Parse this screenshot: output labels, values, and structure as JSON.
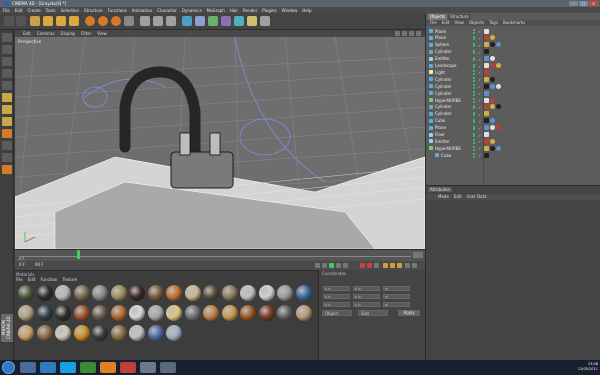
{
  "window": {
    "title": "CINEMA 4D - [Grayskull3 *]"
  },
  "menubar": [
    "File",
    "Edit",
    "Create",
    "Tools",
    "Selection",
    "Structure",
    "Functions",
    "Animation",
    "Character",
    "Dynamics",
    "MoGraph",
    "Hair",
    "Render",
    "Plugins",
    "Window",
    "Help"
  ],
  "viewport": {
    "menu": [
      "Edit",
      "Cameras",
      "Display",
      "Filter",
      "View"
    ],
    "label": "Perspective"
  },
  "timeline": {
    "start": "0 F",
    "end": "90 F",
    "frame": "90 F"
  },
  "materials": {
    "title": "Materials",
    "menu": [
      "File",
      "Edit",
      "Function",
      "Texture"
    ],
    "swatch_colors": [
      "#4a5a3a",
      "#2f2f2f",
      "#b8b8b8",
      "#7a6a4a",
      "#8a8a8a",
      "#9b8f5a",
      "#3a2a20",
      "#7a5a3a",
      "#c07030",
      "#c8b890",
      "#5a4a3a",
      "#8a7a60",
      "#c0c0c0",
      "#d0d0d0",
      "#9a9a9a",
      "#3a6aa0",
      "#b0a080",
      "#30404a",
      "#303030",
      "#a05030",
      "#6a5a4a",
      "#b06a30",
      "#d8d8d8",
      "#a8a8a8",
      "#e0c880",
      "#707070",
      "#c08040",
      "#c89848",
      "#a05820",
      "#7a3a20",
      "#606060",
      "#b89a78",
      "#c8a060",
      "#8a6a4a",
      "#d0c8b8",
      "#d09020",
      "#3a3a3a",
      "#8a7040",
      "#c0c0c0",
      "#4a6aa8",
      "#a0b0c0"
    ]
  },
  "coordinates": {
    "title": "Coordinates",
    "rows": [
      [
        "X",
        "0 m",
        "X",
        "0 m",
        "H",
        "0°"
      ],
      [
        "Y",
        "0 m",
        "Y",
        "0 m",
        "P",
        "0°"
      ],
      [
        "Z",
        "0 m",
        "Z",
        "0 m",
        "B",
        "0°"
      ]
    ],
    "mode_select": "Object",
    "size_select": "Size",
    "apply_label": "Apply"
  },
  "objects": {
    "tabs": [
      "Objects",
      "Structure"
    ],
    "menu": [
      "File",
      "Edit",
      "View",
      "Objects",
      "Tags",
      "Bookmarks"
    ],
    "rows": [
      {
        "name": "Plane",
        "indent": 0,
        "color": "#5ab0e0"
      },
      {
        "name": "Plane",
        "indent": 0,
        "color": "#5ab0e0"
      },
      {
        "name": "Sphere",
        "indent": 0,
        "color": "#5ab0e0"
      },
      {
        "name": "Cylinder",
        "indent": 0,
        "color": "#5ab0e0"
      },
      {
        "name": "Emitter",
        "indent": 0,
        "color": "#9ad0f0"
      },
      {
        "name": "Landscape",
        "indent": 0,
        "color": "#5ab0e0"
      },
      {
        "name": "Light",
        "indent": 0,
        "color": "#f0f0a0"
      },
      {
        "name": "Cylinder",
        "indent": 0,
        "color": "#5ab0e0"
      },
      {
        "name": "Cylinder",
        "indent": 0,
        "color": "#5ab0e0"
      },
      {
        "name": "Cylinder",
        "indent": 0,
        "color": "#5ab0e0"
      },
      {
        "name": "HyperNURBS",
        "indent": 0,
        "color": "#7ad07a"
      },
      {
        "name": "Cylinder",
        "indent": 0,
        "color": "#5ab0e0"
      },
      {
        "name": "Cylinder",
        "indent": 0,
        "color": "#5ab0e0"
      },
      {
        "name": "Cube",
        "indent": 0,
        "color": "#5ab0e0"
      },
      {
        "name": "Plane",
        "indent": 0,
        "color": "#5ab0e0"
      },
      {
        "name": "Floor",
        "indent": 0,
        "color": "#9ad0f0"
      },
      {
        "name": "Emitter",
        "indent": 0,
        "color": "#9ad0f0"
      },
      {
        "name": "HyperNURBS",
        "indent": 0,
        "color": "#7ad07a"
      },
      {
        "name": "Cube",
        "indent": 1,
        "color": "#5ab0e0"
      }
    ]
  },
  "attributes": {
    "tab": "Attributes",
    "menu": [
      "Mode",
      "Edit",
      "User Data"
    ]
  },
  "leftpanel": {
    "vertical_label": "MAXON CINEMA 4D"
  },
  "taskbar": {
    "time": "13:08",
    "date": "11/05/2011"
  }
}
